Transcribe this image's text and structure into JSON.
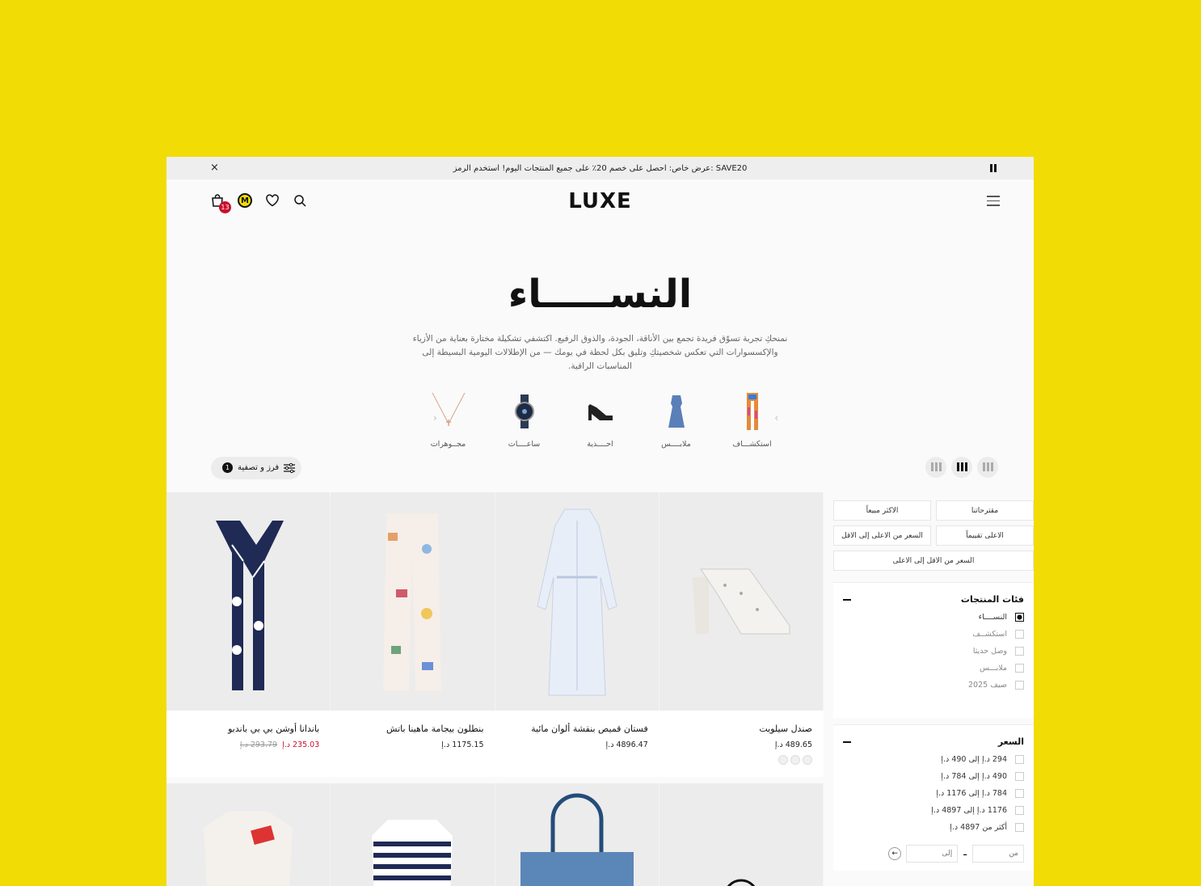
{
  "announcement": {
    "text": "عرض خاص: احصل على خصم 20٪ على جميع المنتجات اليوم! استخدم الرمز: SAVE20",
    "close": "×"
  },
  "header": {
    "logo": "LUXE",
    "cart_count": "13",
    "brand_mark": "M"
  },
  "hero": {
    "title": "النســـــاء",
    "description": "نمنحكِ تجربة تسوّق فريدة تجمع بين الأناقة، الجودة، والذوق الرفيع. اكتشفي تشكيلة مختارة بعناية من الأزياء والإكسسوارات التي تعكس شخصيتكِ وتليق بكل لحظة في يومك — من الإطلالات اليومية البسيطة إلى المناسبات الراقية."
  },
  "categories": [
    {
      "label": "استكشـــاف",
      "icon": "scarf-icon"
    },
    {
      "label": "ملابــــس",
      "icon": "dress-icon"
    },
    {
      "label": "احــــذية",
      "icon": "shoe-icon"
    },
    {
      "label": "ساعــــات",
      "icon": "watch-icon"
    },
    {
      "label": "مجــوهرات",
      "icon": "necklace-icon"
    }
  ],
  "toolbar": {
    "filter_label": "فرز و تصفية",
    "filter_count": "1"
  },
  "products_row1": [
    {
      "name": "صندل سيلويت",
      "price": "489.65 د.إ",
      "old_price": "",
      "image": "sandal-image"
    },
    {
      "name": "فستان قميص بنقشة ألوان مائية",
      "price": "4896.47 د.إ",
      "old_price": "",
      "image": "coat-dress-image"
    },
    {
      "name": "بنطلون بيجامة ماهينا باتش",
      "price": "1175.15 د.إ",
      "old_price": "",
      "image": "pajama-pants-image"
    },
    {
      "name": "باندانا أوشن بي بي باندبو",
      "price": "235.03 د.إ",
      "old_price": "293.79 د.إ",
      "image": "bandana-image"
    }
  ],
  "sort_options": {
    "recommended": "مقترحاتنا",
    "best_selling": "الاكثر مبيعاً",
    "top_rated": "الاعلى تقييماً",
    "price_desc": "السعر من الاعلى إلى الاقل",
    "price_asc": "السعر من الاقل إلى الاعلى"
  },
  "filters": {
    "categories_title": "فئات المنتجات",
    "categories": [
      "النســــاء",
      "استكشــف",
      "وصل حديثا",
      "ملابـــس",
      "صيف 2025"
    ],
    "price_title": "السعر",
    "prices": [
      "294 د.إ إلى 490 د.إ",
      "490 د.إ إلى 784 د.إ",
      "784 د.إ إلى 1176 د.إ",
      "1176 د.إ إلى 4897 د.إ",
      "أكثر من 4897 د.إ"
    ],
    "from_placeholder": "من",
    "to_placeholder": "إلى",
    "currency": "د.إ",
    "range_sep": "-"
  }
}
